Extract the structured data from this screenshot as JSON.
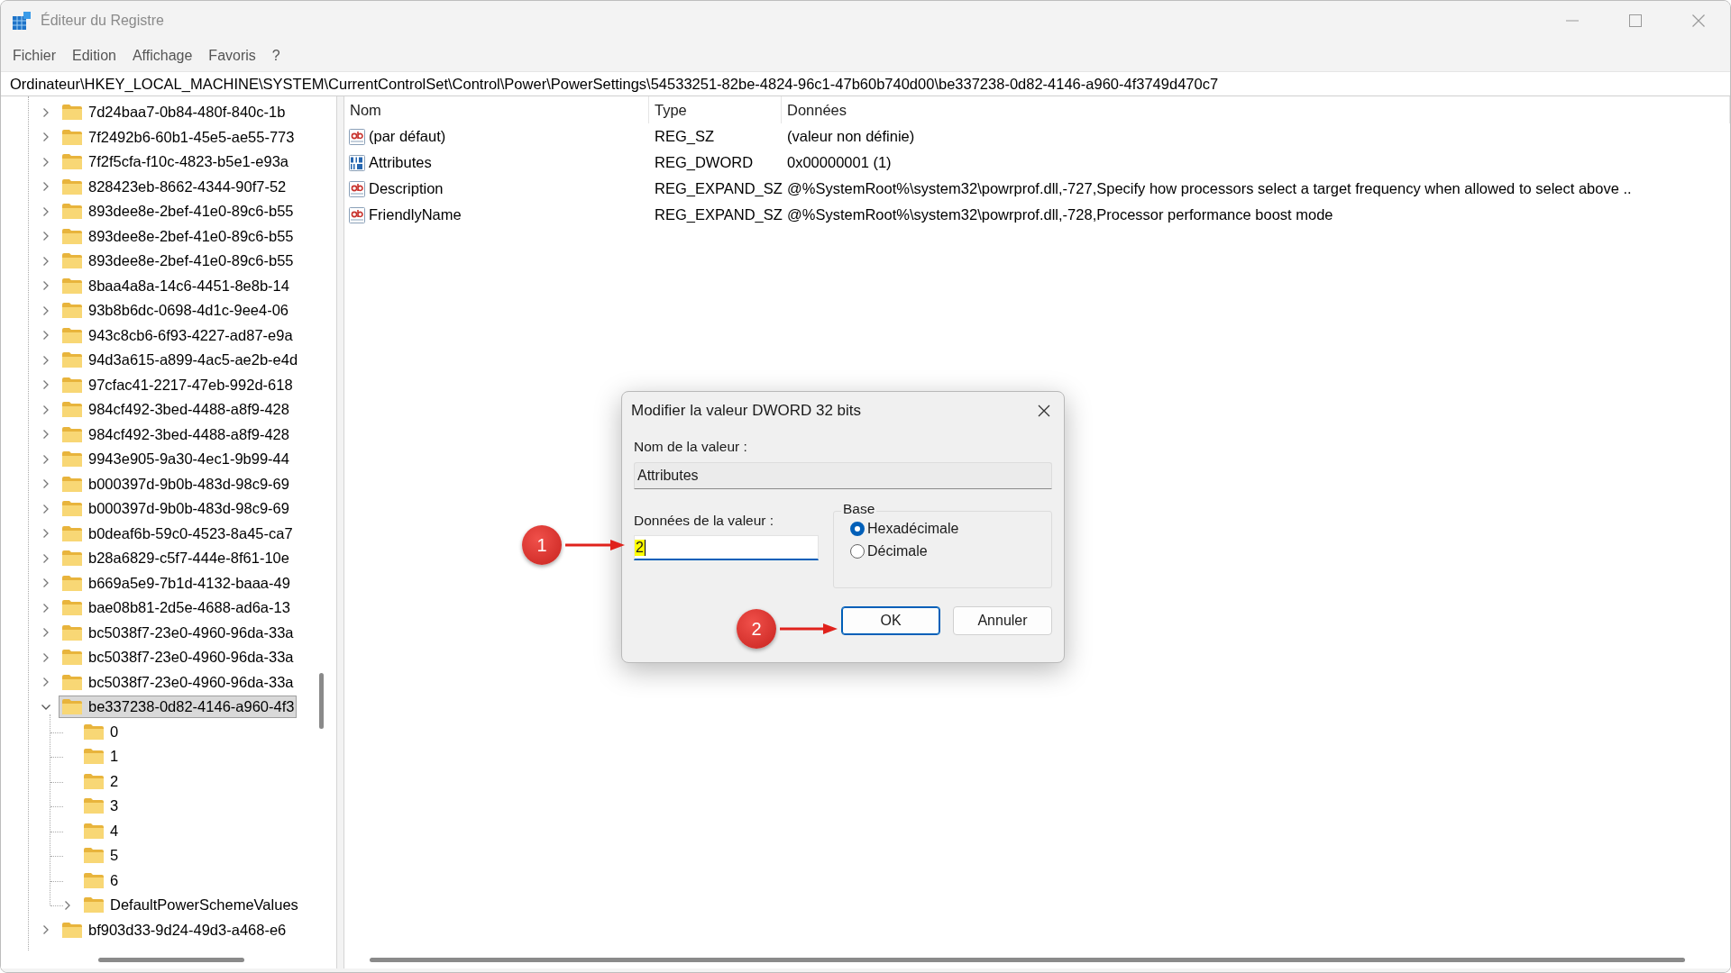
{
  "window": {
    "title": "Éditeur du Registre"
  },
  "menu": [
    "Fichier",
    "Edition",
    "Affichage",
    "Favoris",
    "?"
  ],
  "address": "Ordinateur\\HKEY_LOCAL_MACHINE\\SYSTEM\\CurrentControlSet\\Control\\Power\\PowerSettings\\54533251-82be-4824-96c1-47b60b740d00\\be337238-0d82-4146-a960-4f3749d470c7",
  "tree": {
    "items": [
      {
        "label": "7d24baa7-0b84-480f-840c-1b",
        "expandable": true,
        "expanded": false,
        "selected": false
      },
      {
        "label": "7f2492b6-60b1-45e5-ae55-773",
        "expandable": true,
        "expanded": false,
        "selected": false
      },
      {
        "label": "7f2f5cfa-f10c-4823-b5e1-e93a",
        "expandable": true,
        "expanded": false,
        "selected": false
      },
      {
        "label": "828423eb-8662-4344-90f7-52",
        "expandable": true,
        "expanded": false,
        "selected": false
      },
      {
        "label": "893dee8e-2bef-41e0-89c6-b55",
        "expandable": true,
        "expanded": false,
        "selected": false
      },
      {
        "label": "893dee8e-2bef-41e0-89c6-b55",
        "expandable": true,
        "expanded": false,
        "selected": false
      },
      {
        "label": "893dee8e-2bef-41e0-89c6-b55",
        "expandable": true,
        "expanded": false,
        "selected": false
      },
      {
        "label": "8baa4a8a-14c6-4451-8e8b-14",
        "expandable": true,
        "expanded": false,
        "selected": false
      },
      {
        "label": "93b8b6dc-0698-4d1c-9ee4-06",
        "expandable": true,
        "expanded": false,
        "selected": false
      },
      {
        "label": "943c8cb6-6f93-4227-ad87-e9a",
        "expandable": true,
        "expanded": false,
        "selected": false
      },
      {
        "label": "94d3a615-a899-4ac5-ae2b-e4d",
        "expandable": true,
        "expanded": false,
        "selected": false
      },
      {
        "label": "97cfac41-2217-47eb-992d-618",
        "expandable": true,
        "expanded": false,
        "selected": false
      },
      {
        "label": "984cf492-3bed-4488-a8f9-428",
        "expandable": true,
        "expanded": false,
        "selected": false
      },
      {
        "label": "984cf492-3bed-4488-a8f9-428",
        "expandable": true,
        "expanded": false,
        "selected": false
      },
      {
        "label": "9943e905-9a30-4ec1-9b99-44",
        "expandable": true,
        "expanded": false,
        "selected": false
      },
      {
        "label": "b000397d-9b0b-483d-98c9-69",
        "expandable": true,
        "expanded": false,
        "selected": false
      },
      {
        "label": "b000397d-9b0b-483d-98c9-69",
        "expandable": true,
        "expanded": false,
        "selected": false
      },
      {
        "label": "b0deaf6b-59c0-4523-8a45-ca7",
        "expandable": true,
        "expanded": false,
        "selected": false
      },
      {
        "label": "b28a6829-c5f7-444e-8f61-10e",
        "expandable": true,
        "expanded": false,
        "selected": false
      },
      {
        "label": "b669a5e9-7b1d-4132-baaa-49",
        "expandable": true,
        "expanded": false,
        "selected": false
      },
      {
        "label": "bae08b81-2d5e-4688-ad6a-13",
        "expandable": true,
        "expanded": false,
        "selected": false
      },
      {
        "label": "bc5038f7-23e0-4960-96da-33a",
        "expandable": true,
        "expanded": false,
        "selected": false
      },
      {
        "label": "bc5038f7-23e0-4960-96da-33a",
        "expandable": true,
        "expanded": false,
        "selected": false
      },
      {
        "label": "bc5038f7-23e0-4960-96da-33a",
        "expandable": true,
        "expanded": false,
        "selected": false
      },
      {
        "label": "be337238-0d82-4146-a960-4f3",
        "expandable": true,
        "expanded": true,
        "selected": true,
        "children": [
          {
            "label": "0",
            "expandable": false,
            "selected": false
          },
          {
            "label": "1",
            "expandable": false,
            "selected": false
          },
          {
            "label": "2",
            "expandable": false,
            "selected": false
          },
          {
            "label": "3",
            "expandable": false,
            "selected": false
          },
          {
            "label": "4",
            "expandable": false,
            "selected": false
          },
          {
            "label": "5",
            "expandable": false,
            "selected": false
          },
          {
            "label": "6",
            "expandable": false,
            "selected": false
          },
          {
            "label": "DefaultPowerSchemeValues",
            "expandable": true,
            "expanded": false,
            "selected": false
          }
        ]
      },
      {
        "label": "bf903d33-9d24-49d3-a468-e6",
        "expandable": true,
        "expanded": false,
        "selected": false
      }
    ]
  },
  "values": {
    "columns": [
      "Nom",
      "Type",
      "Données"
    ],
    "rows": [
      {
        "kind": "string",
        "name": "(par défaut)",
        "type": "REG_SZ",
        "data": "(valeur non définie)"
      },
      {
        "kind": "binary",
        "name": "Attributes",
        "type": "REG_DWORD",
        "data": "0x00000001 (1)"
      },
      {
        "kind": "string",
        "name": "Description",
        "type": "REG_EXPAND_SZ",
        "data": "@%SystemRoot%\\system32\\powrprof.dll,-727,Specify how processors select a target frequency when allowed to select above .."
      },
      {
        "kind": "string",
        "name": "FriendlyName",
        "type": "REG_EXPAND_SZ",
        "data": "@%SystemRoot%\\system32\\powrprof.dll,-728,Processor performance boost mode"
      }
    ]
  },
  "dialog": {
    "title": "Modifier la valeur DWORD 32 bits",
    "name_label": "Nom de la valeur :",
    "name_value": "Attributes",
    "data_label": "Données de la valeur :",
    "data_value": "2",
    "highlighted": true,
    "base": {
      "label": "Base",
      "options": [
        {
          "label": "Hexadécimale",
          "selected": true
        },
        {
          "label": "Décimale",
          "selected": false
        }
      ]
    },
    "buttons": [
      {
        "label": "OK",
        "default": true
      },
      {
        "label": "Annuler",
        "default": false
      }
    ]
  },
  "annotations": [
    {
      "number": "1"
    },
    {
      "number": "2"
    }
  ]
}
